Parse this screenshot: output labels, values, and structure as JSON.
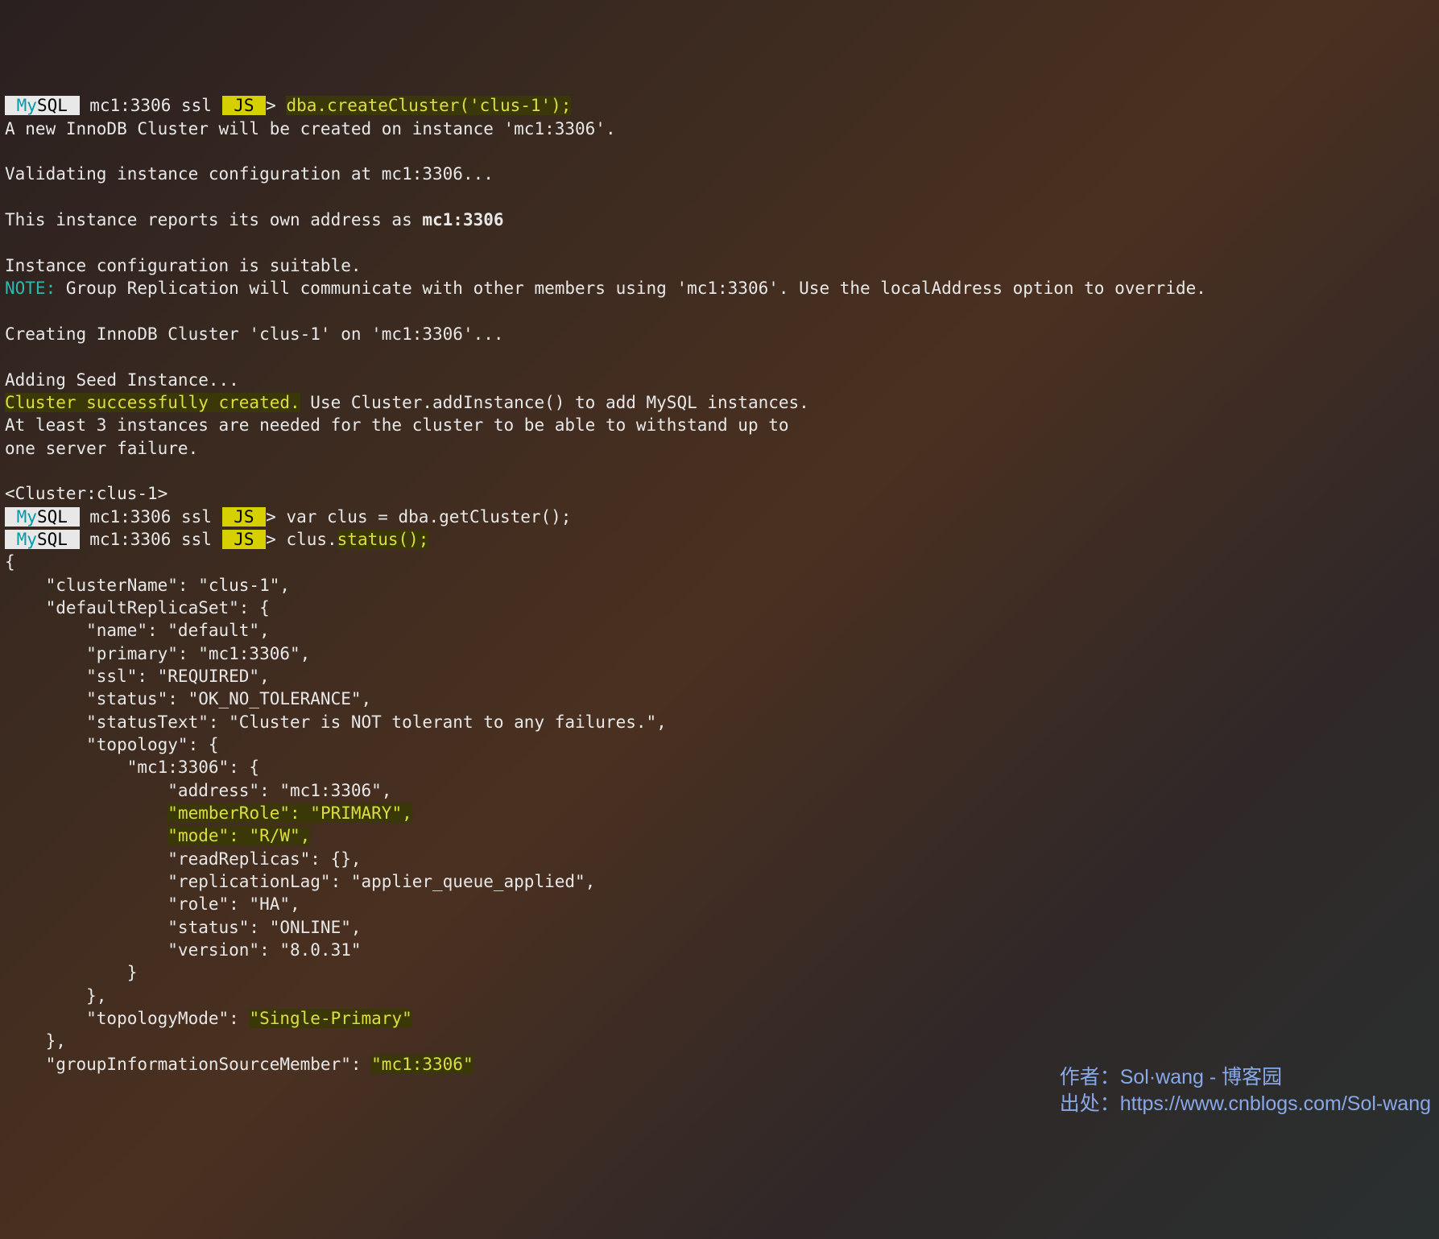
{
  "prompt": {
    "mysql_my": "My",
    "mysql_sql": "SQL",
    "host": " mc1:3306 ssl ",
    "js": " JS ",
    "arrow": "> "
  },
  "cmd1": "dba.createCluster('clus-1');",
  "out1_l1": "A new InnoDB Cluster will be created on instance 'mc1:3306'.",
  "out1_l2": "Validating instance configuration at mc1:3306...",
  "out1_l3a": "This instance reports its own address as ",
  "out1_l3b": "mc1:3306",
  "out1_l4": "Instance configuration is suitable.",
  "note_label": "NOTE:",
  "note_text": " Group Replication will communicate with other members using 'mc1:3306'. Use the localAddress option to override.",
  "out1_l5": "Creating InnoDB Cluster 'clus-1' on 'mc1:3306'...",
  "out1_l6": "Adding Seed Instance...",
  "success": "Cluster successfully created.",
  "success_tail": " Use Cluster.addInstance() to add MySQL instances.",
  "out1_l7": "At least 3 instances are needed for the cluster to be able to withstand up to",
  "out1_l8": "one server failure.",
  "cluster_tag": "<Cluster:clus-1>",
  "cmd2": "var clus = dba.getCluster();",
  "cmd3_a": "clus.",
  "cmd3_b": "status();",
  "json": {
    "open": "{",
    "l1": "    \"clusterName\": \"clus-1\",",
    "l2": "    \"defaultReplicaSet\": {",
    "l3": "        \"name\": \"default\",",
    "l4": "        \"primary\": \"mc1:3306\",",
    "l5": "        \"ssl\": \"REQUIRED\",",
    "l6": "        \"status\": \"OK_NO_TOLERANCE\",",
    "l7": "        \"statusText\": \"Cluster is NOT tolerant to any failures.\",",
    "l8": "        \"topology\": {",
    "l9": "            \"mc1:3306\": {",
    "l10": "                \"address\": \"mc1:3306\",",
    "l11_hl": "\"memberRole\": \"PRIMARY\",",
    "l11_pad": "                ",
    "l12_hl": "\"mode\": \"R/W\",",
    "l12_pad": "                ",
    "l13": "                \"readReplicas\": {},",
    "l14": "                \"replicationLag\": \"applier_queue_applied\",",
    "l15": "                \"role\": \"HA\",",
    "l16": "                \"status\": \"ONLINE\",",
    "l17": "                \"version\": \"8.0.31\"",
    "l18": "            }",
    "l19": "        },",
    "l20_a": "        \"topologyMode\": ",
    "l20_b": "\"Single-Primary\"",
    "l21": "    },",
    "l22_a": "    \"groupInformationSourceMember\": ",
    "l22_b": "\"mc1:3306\""
  },
  "watermark": {
    "l1": "作者：Sol·wang - 博客园",
    "l2": "出处：https://www.cnblogs.com/Sol-wang"
  }
}
